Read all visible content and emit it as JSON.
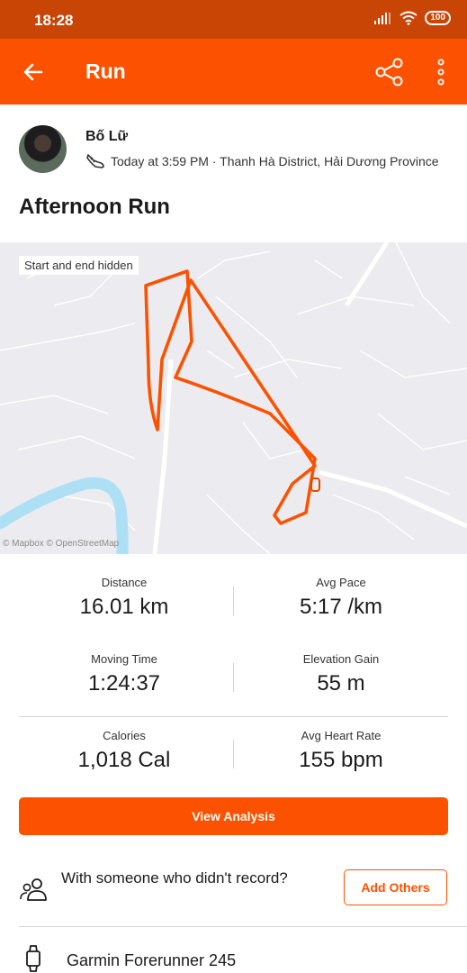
{
  "status_bar": {
    "time": "18:28",
    "battery": "100"
  },
  "app_bar": {
    "title": "Run",
    "icons": [
      "back-arrow-icon",
      "share-icon",
      "more-icon"
    ]
  },
  "athlete": {
    "name": "Bố Lữ",
    "meta": "Today at 3:59 PM · Thanh Hà District, Hải Dương Province",
    "meta_icon": "shoe-icon"
  },
  "activity": {
    "title": "Afternoon Run"
  },
  "map": {
    "label": "Start and end hidden",
    "credit": "© Mapbox © OpenStreetMap",
    "route_color": "#fc5200",
    "river_color": "#aee0f5"
  },
  "stats": [
    {
      "label": "Distance",
      "value": "16.01 km"
    },
    {
      "label": "Avg Pace",
      "value": "5:17 /km"
    },
    {
      "label": "Moving Time",
      "value": "1:24:37"
    },
    {
      "label": "Elevation Gain",
      "value": "55 m"
    },
    {
      "label": "Calories",
      "value": "1,018 Cal"
    },
    {
      "label": "Avg Heart Rate",
      "value": "155 bpm"
    }
  ],
  "actions": {
    "view_analysis": "View Analysis",
    "with_someone": "With someone who didn't record?",
    "add_others": "Add Others"
  },
  "device": {
    "name": "Garmin Forerunner 245"
  },
  "colors": {
    "brand": "#fc5200",
    "status_bar": "#c94506"
  }
}
